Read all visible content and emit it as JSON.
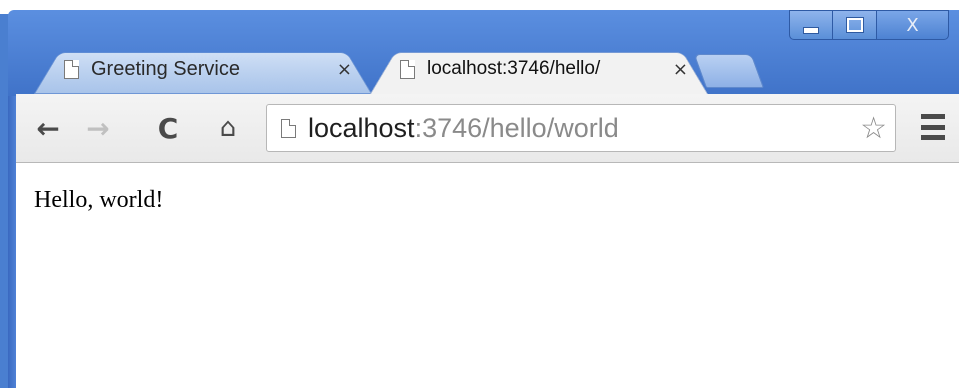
{
  "window": {
    "controls": {
      "minimize_icon": "minimize-icon",
      "maximize_icon": "maximize-icon",
      "close_label": "X"
    }
  },
  "tabs": [
    {
      "label": "Greeting Service",
      "close_label": "×",
      "active": false
    },
    {
      "label": "localhost:3746/hello/",
      "close_label": "×",
      "active": true
    }
  ],
  "toolbar": {
    "back_label": "←",
    "forward_label": "→",
    "reload_label": "C",
    "home_label": "⌂",
    "address": {
      "host": "localhost",
      "rest": ":3746/hello/world"
    },
    "star_label": "☆"
  },
  "page": {
    "text": "Hello, world!"
  },
  "colors": {
    "frame": "#4a7fd0",
    "active_tab": "#f2f2f2",
    "inactive_tab": "#b9d0f2"
  }
}
